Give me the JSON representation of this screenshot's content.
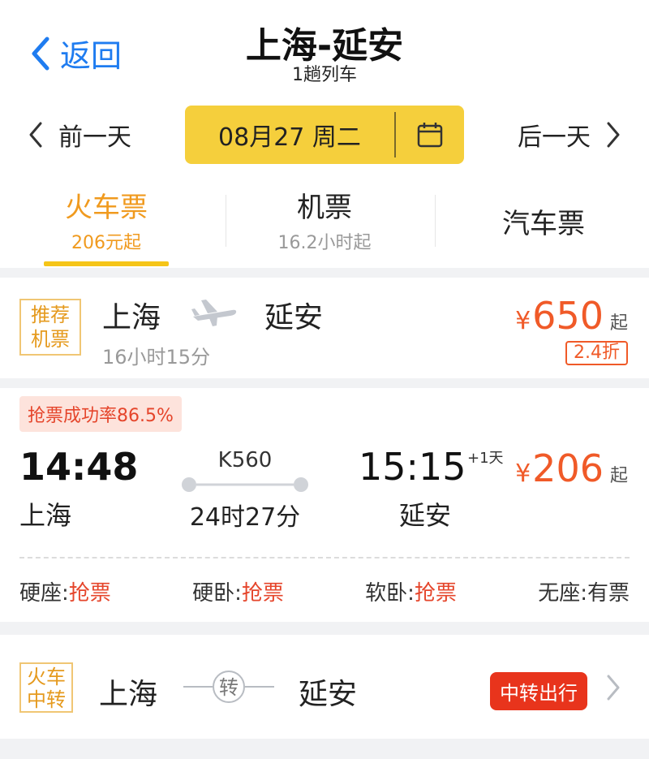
{
  "header": {
    "back_label": "返回",
    "title": "上海-延安",
    "subtitle": "1趟列车"
  },
  "date_nav": {
    "prev_label": "前一天",
    "date": "08月27 周二",
    "next_label": "后一天"
  },
  "tabs": [
    {
      "label": "火车票",
      "sub": "206元起",
      "active": true
    },
    {
      "label": "机票",
      "sub": "16.2小时起",
      "active": false
    },
    {
      "label": "汽车票",
      "sub": "",
      "active": false
    }
  ],
  "flight_card": {
    "badge_line1": "推荐",
    "badge_line2": "机票",
    "from": "上海",
    "to": "延安",
    "duration": "16小时15分",
    "currency": "¥",
    "price": "650",
    "price_suffix": "起",
    "discount": "2.4折"
  },
  "train_card": {
    "success_rate": "抢票成功率86.5%",
    "depart_time": "14:48",
    "depart_station": "上海",
    "train_number": "K560",
    "duration": "24时27分",
    "arrive_time": "15:15",
    "day_offset": "+1天",
    "arrive_station": "延安",
    "currency": "¥",
    "price": "206",
    "price_suffix": "起",
    "seats": [
      {
        "name": "硬座:",
        "status": "抢票"
      },
      {
        "name": "硬卧:",
        "status": "抢票"
      },
      {
        "name": "软卧:",
        "status": "抢票"
      },
      {
        "name": "无座:",
        "status": "有票"
      }
    ]
  },
  "transfer_card": {
    "badge_line1": "火车",
    "badge_line2": "中转",
    "from": "上海",
    "via": "转",
    "to": "延安",
    "button": "中转出行"
  },
  "colors": {
    "accent_blue": "#1f7cf0",
    "date_yellow": "#f5cf3c",
    "tab_orange": "#f09a1e",
    "price_red": "#f05a28",
    "transfer_red": "#e8341c"
  }
}
